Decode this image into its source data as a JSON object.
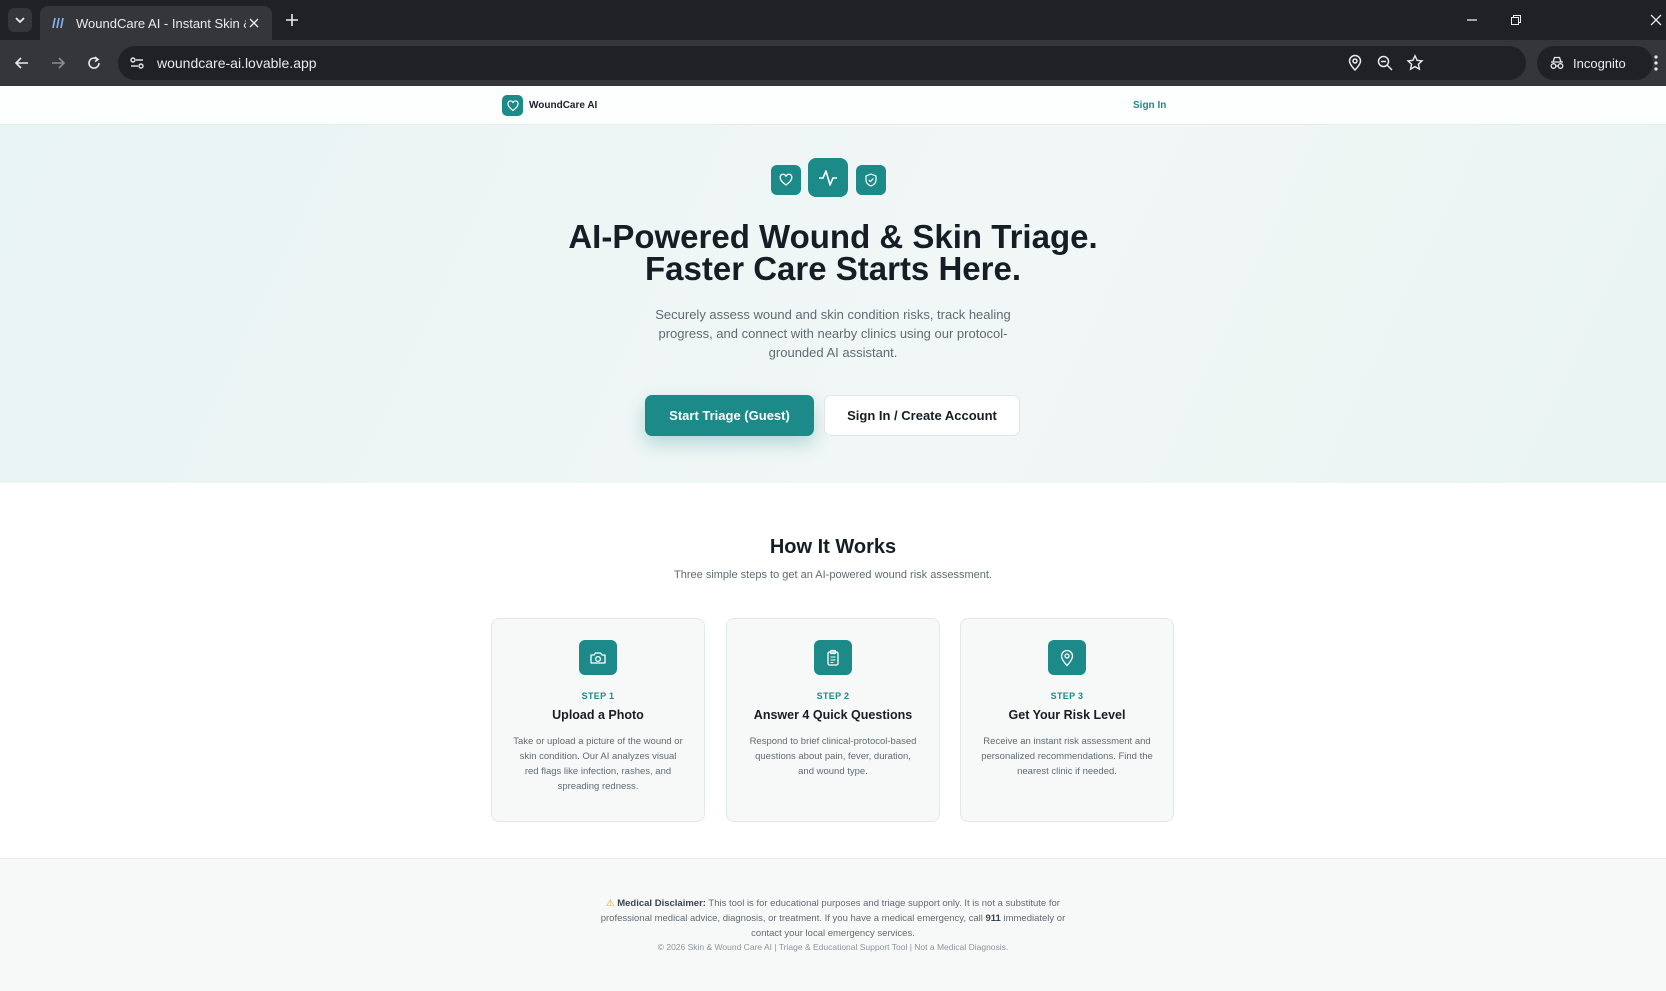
{
  "browser": {
    "tab_title": "WoundCare AI - Instant Skin &",
    "url": "woundcare-ai.lovable.app",
    "incognito_label": "Incognito"
  },
  "header": {
    "brand": "WoundCare AI",
    "signin": "Sign In"
  },
  "hero": {
    "title_line1": "AI-Powered Wound & Skin Triage.",
    "title_line2": "Faster Care Starts Here.",
    "subtitle": "Securely assess wound and skin condition risks, track healing progress, and connect with nearby clinics using our protocol-grounded AI assistant.",
    "primary_button": "Start Triage (Guest)",
    "secondary_button": "Sign In / Create Account"
  },
  "how": {
    "title": "How It Works",
    "subtitle": "Three simple steps to get an AI-powered wound risk assessment.",
    "steps": [
      {
        "step": "STEP 1",
        "title": "Upload a Photo",
        "desc": "Take or upload a picture of the wound or skin condition. Our AI analyzes visual red flags like infection, rashes, and spreading redness.",
        "icon": "camera-icon"
      },
      {
        "step": "STEP 2",
        "title": "Answer 4 Quick Questions",
        "desc": "Respond to brief clinical-protocol-based questions about pain, fever, duration, and wound type.",
        "icon": "clipboard-icon"
      },
      {
        "step": "STEP 3",
        "title": "Get Your Risk Level",
        "desc": "Receive an instant risk assessment and personalized recommendations. Find the nearest clinic if needed.",
        "icon": "map-pin-icon"
      }
    ]
  },
  "footer": {
    "disclaimer_label": "Medical Disclaimer:",
    "disclaimer_part1": "This tool is for educational purposes and triage support only. It is not a substitute for professional medical advice, diagnosis, or treatment. If you have a medical emergency, call",
    "emergency_number": "911",
    "disclaimer_part2": "immediately or contact your local emergency services.",
    "copyright": "© 2026 Skin & Wound Care AI | Triage & Educational Support Tool | Not a Medical Diagnosis."
  },
  "colors": {
    "accent": "#1b8a88",
    "browser_dark": "#202124",
    "browser_toolbar": "#35363a"
  }
}
